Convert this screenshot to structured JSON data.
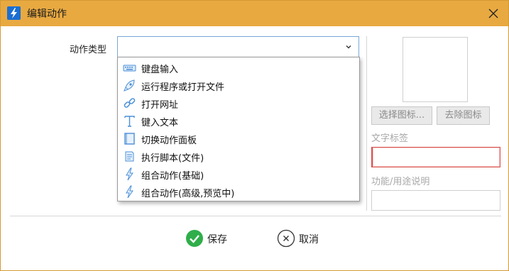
{
  "window": {
    "title": "编辑动作"
  },
  "form": {
    "action_type_label": "动作类型",
    "action_type_value": "",
    "options": [
      {
        "label": "键盘输入",
        "icon": "keyboard-icon"
      },
      {
        "label": "运行程序或打开文件",
        "icon": "rocket-icon"
      },
      {
        "label": "打开网址",
        "icon": "link-icon"
      },
      {
        "label": "键入文本",
        "icon": "text-t-icon"
      },
      {
        "label": "切换动作面板",
        "icon": "panel-icon"
      },
      {
        "label": "执行脚本(文件)",
        "icon": "script-icon"
      },
      {
        "label": "组合动作(基础)",
        "icon": "lightning-icon"
      },
      {
        "label": "组合动作(高级,预览中)",
        "icon": "lightning-icon"
      }
    ]
  },
  "side": {
    "choose_icon_label": "选择图标...",
    "remove_icon_label": "去除图标",
    "text_label_caption": "文字标签",
    "text_label_value": "",
    "desc_caption": "功能/用途说明",
    "desc_value": ""
  },
  "footer": {
    "save_label": "保存",
    "cancel_label": "取消"
  },
  "colors": {
    "titlebar": "#e8a941",
    "accent_blue": "#1b6fd1",
    "save_green": "#2fae4a",
    "error_border": "#d9534f"
  }
}
